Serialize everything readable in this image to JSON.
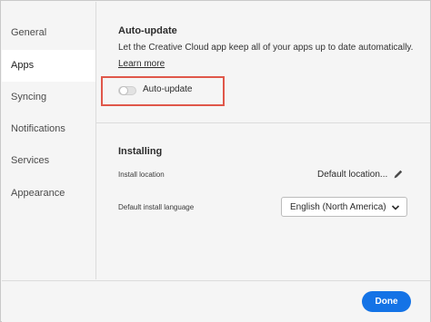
{
  "sidebar": {
    "items": [
      {
        "label": "General",
        "active": false
      },
      {
        "label": "Apps",
        "active": true
      },
      {
        "label": "Syncing",
        "active": false
      },
      {
        "label": "Notifications",
        "active": false
      },
      {
        "label": "Services",
        "active": false
      },
      {
        "label": "Appearance",
        "active": false
      }
    ]
  },
  "auto_update": {
    "title": "Auto-update",
    "description": "Let the Creative Cloud app keep all of your apps up to date automatically.",
    "learn_more": "Learn more",
    "toggle_label": "Auto-update",
    "toggle_on": false,
    "highlight_color": "#e0574a"
  },
  "installing": {
    "title": "Installing",
    "install_location_label": "Install location",
    "install_location_value": "Default location...",
    "language_label": "Default install language",
    "language_value": "English (North America)"
  },
  "footer": {
    "done_label": "Done",
    "accent_color": "#1473e6"
  },
  "icons": {
    "edit": "pencil-icon",
    "dropdown": "chevron-down-icon"
  }
}
